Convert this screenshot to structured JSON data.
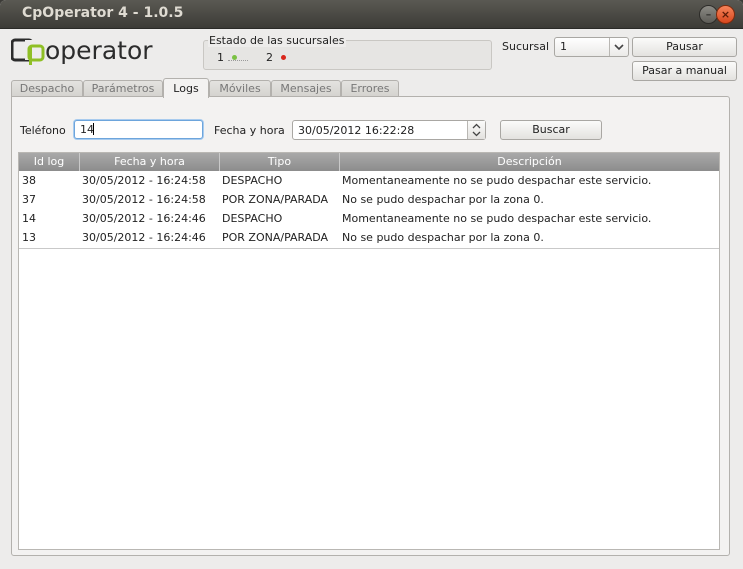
{
  "window": {
    "title": "CpOperator 4 - 1.0.5",
    "minimize_symbol": "–",
    "close_symbol": "×"
  },
  "logo": {
    "text": "cpoperator",
    "color": "#2c2c2c",
    "accent": "#8fbf25"
  },
  "branch_status": {
    "title": "Estado de las sucursales",
    "branches": [
      {
        "label": "1",
        "status_color": "#7ac143"
      },
      {
        "label": "2",
        "status_color": "#d9261c"
      }
    ]
  },
  "branch_selector": {
    "label": "Sucursal",
    "value": "1",
    "icon": "chevron-down-icon"
  },
  "buttons": {
    "pause": "Pausar",
    "manual": "Pasar a manual",
    "search": "Buscar"
  },
  "tabs": [
    {
      "label": "Despacho",
      "active": false
    },
    {
      "label": "Parámetros",
      "active": false
    },
    {
      "label": "Logs",
      "active": true
    },
    {
      "label": "Móviles",
      "active": false
    },
    {
      "label": "Mensajes",
      "active": false
    },
    {
      "label": "Errores",
      "active": false
    }
  ],
  "filters": {
    "phone_label": "Teléfono",
    "phone_value": "14",
    "datetime_label": "Fecha y hora",
    "datetime_value": "30/05/2012 16:22:28"
  },
  "logs_table": {
    "columns": [
      "Id log",
      "Fecha y hora",
      "Tipo",
      "Descripción"
    ],
    "rows": [
      [
        "38",
        "30/05/2012 - 16:24:58",
        "DESPACHO",
        "Momentaneamente no se pudo despachar este servicio."
      ],
      [
        "37",
        "30/05/2012 - 16:24:58",
        "POR ZONA/PARADA",
        "No se pudo despachar por la zona 0."
      ],
      [
        "14",
        "30/05/2012 - 16:24:46",
        "DESPACHO",
        "Momentaneamente no se pudo despachar este servicio."
      ],
      [
        "13",
        "30/05/2012 - 16:24:46",
        "POR ZONA/PARADA",
        "No se pudo despachar por la zona 0."
      ]
    ]
  }
}
